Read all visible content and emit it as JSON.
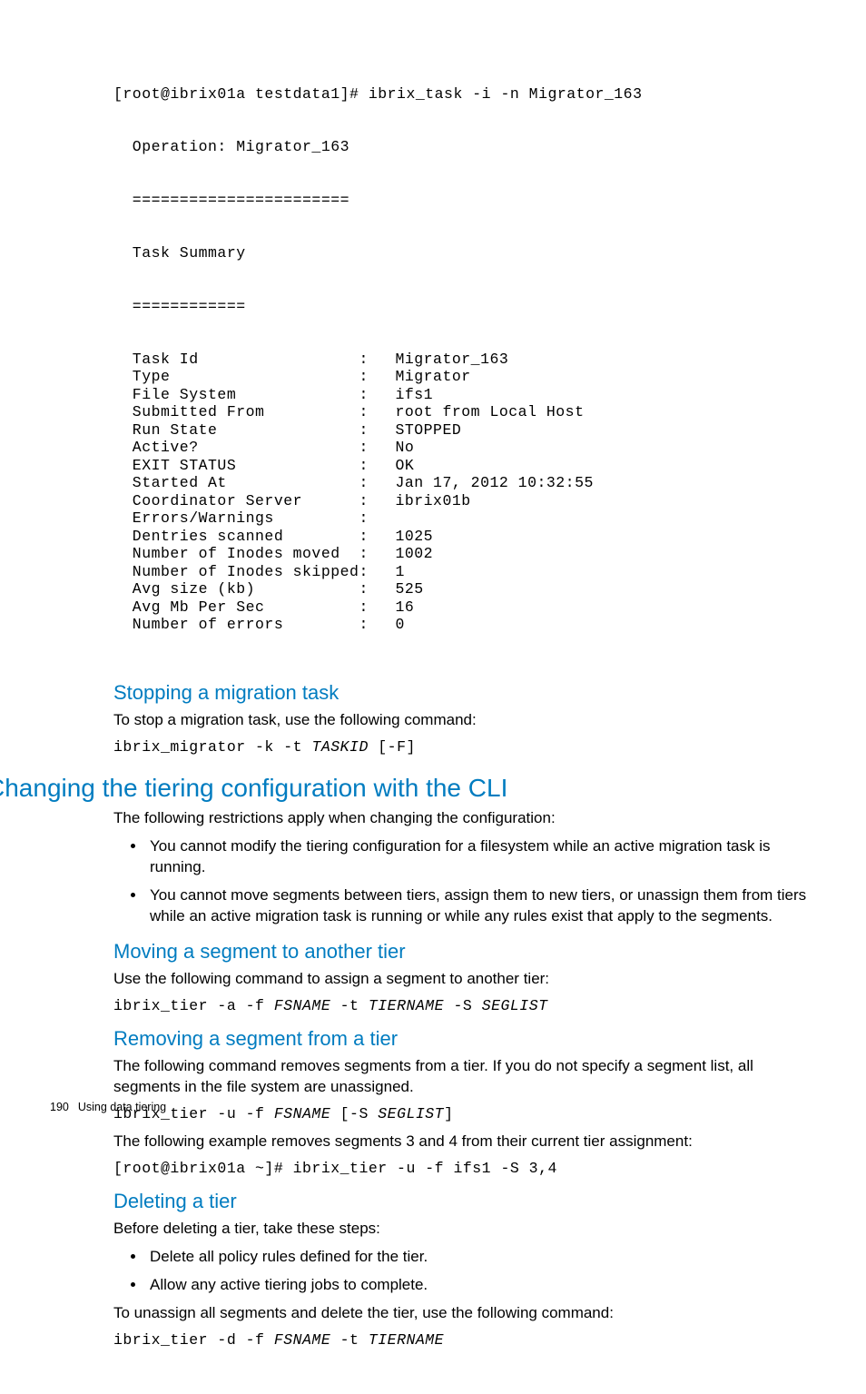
{
  "terminal": {
    "command_line": "[root@ibrix01a testdata1]# ibrix_task -i -n Migrator_163",
    "header1": "  Operation: Migrator_163",
    "header2": "  =======================",
    "header3": "  Task Summary",
    "header4": "  ============",
    "rows": [
      {
        "label": "  Task Id",
        "colon": ":  ",
        "value": "Migrator_163"
      },
      {
        "label": "  Type",
        "colon": ":  ",
        "value": "Migrator"
      },
      {
        "label": "  File System",
        "colon": ":  ",
        "value": "ifs1"
      },
      {
        "label": "  Submitted From",
        "colon": ":  ",
        "value": "root from Local Host"
      },
      {
        "label": "  Run State",
        "colon": ":  ",
        "value": "STOPPED"
      },
      {
        "label": "  Active?",
        "colon": ":  ",
        "value": "No"
      },
      {
        "label": "  EXIT STATUS",
        "colon": ":  ",
        "value": "OK"
      },
      {
        "label": "  Started At",
        "colon": ":  ",
        "value": "Jan 17, 2012 10:32:55"
      },
      {
        "label": "  Coordinator Server",
        "colon": ":  ",
        "value": "ibrix01b"
      },
      {
        "label": "  Errors/Warnings",
        "colon": ":",
        "value": ""
      },
      {
        "label": "  Dentries scanned",
        "colon": ":  ",
        "value": "1025"
      },
      {
        "label": "  Number of Inodes moved",
        "colon": ":  ",
        "value": "1002"
      },
      {
        "label": "  Number of Inodes skipped",
        "colon": ":  ",
        "value": "1"
      },
      {
        "label": "  Avg size (kb)",
        "colon": ":  ",
        "value": "525"
      },
      {
        "label": "  Avg Mb Per Sec",
        "colon": ":  ",
        "value": "16"
      },
      {
        "label": "  Number of errors",
        "colon": ":  ",
        "value": "0"
      }
    ]
  },
  "section_stop": {
    "heading": "Stopping a migration task",
    "intro": "To stop a migration task, use the following command:",
    "cmd_prefix": "ibrix_migrator -k -t ",
    "cmd_var": "TASKID",
    "cmd_suffix": " [-F]"
  },
  "section_change": {
    "heading": "Changing the tiering configuration with the CLI",
    "intro": "The following restrictions apply when changing the configuration:",
    "bullets": [
      "You cannot modify the tiering configuration for a filesystem while an active migration task is running.",
      "You cannot move segments between tiers, assign them to new tiers, or unassign them from tiers while an active migration task is running or while any rules exist that apply to the segments."
    ]
  },
  "section_move": {
    "heading": "Moving a segment to another tier",
    "intro": "Use the following command to assign a segment to another tier:",
    "p0": "ibrix_tier -a -f ",
    "v0": "FSNAME",
    "p1": " -t ",
    "v1": "TIERNAME",
    "p2": " -S ",
    "v2": "SEGLIST"
  },
  "section_remove": {
    "heading": "Removing a segment from a tier",
    "intro": "The following command removes segments from a tier. If you do not specify a segment list, all segments in the file system are unassigned.",
    "p0": "ibrix_tier -u -f ",
    "v0": "FSNAME",
    "p1": " [-S ",
    "v1": "SEGLIST",
    "p2": "]",
    "example_intro": "The following example removes segments 3 and 4 from their current tier assignment:",
    "example_cmd": "[root@ibrix01a ~]# ibrix_tier -u -f ifs1 -S 3,4"
  },
  "section_delete": {
    "heading": "Deleting a tier",
    "intro": "Before deleting a tier, take these steps:",
    "bullets": [
      "Delete all policy rules defined for the tier.",
      "Allow any active tiering jobs to complete."
    ],
    "outro": "To unassign all segments and delete the tier, use the following command:",
    "p0": "ibrix_tier -d -f ",
    "v0": "FSNAME",
    "p1": " -t ",
    "v1": "TIERNAME"
  },
  "footer": {
    "page_number": "190",
    "chapter": "Using data tiering"
  }
}
